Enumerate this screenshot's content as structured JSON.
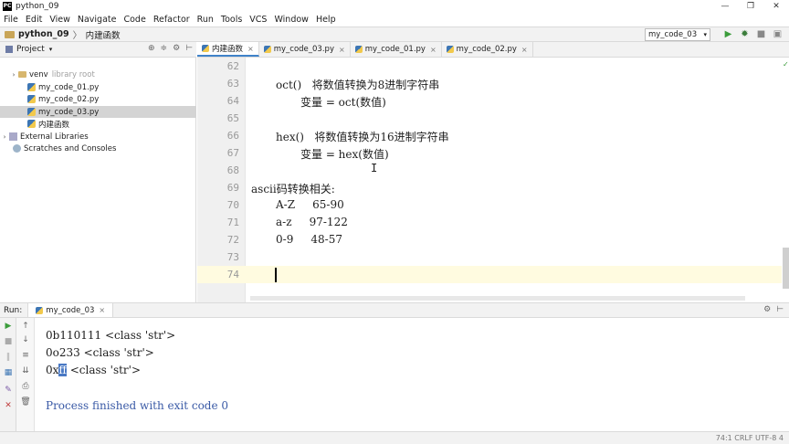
{
  "window": {
    "logo": "PC",
    "title": "python_09",
    "controls": [
      "—",
      "❐",
      "✕"
    ]
  },
  "menu": [
    "File",
    "Edit",
    "View",
    "Navigate",
    "Code",
    "Refactor",
    "Run",
    "Tools",
    "VCS",
    "Window",
    "Help"
  ],
  "navbar": {
    "project": "python_09",
    "separator": "〉",
    "file": "内建函数",
    "run_config": "my_code_03",
    "run_config_chevron": "▾",
    "tools": {
      "run": "▶",
      "debug": "✹",
      "stop": "■",
      "more": "▣"
    }
  },
  "project_panel": {
    "label": "Project",
    "chevron": "▾",
    "tools": [
      "⊕",
      "≑",
      "⚙",
      "⊢"
    ],
    "tree": [
      {
        "arrow": "›",
        "icon": "folder",
        "label": "venv",
        "extra": "library root",
        "selected": false
      },
      {
        "arrow": "",
        "icon": "py",
        "label": "my_code_01.py",
        "extra": "",
        "selected": false
      },
      {
        "arrow": "",
        "icon": "py",
        "label": "my_code_02.py",
        "extra": "",
        "selected": false
      },
      {
        "arrow": "",
        "icon": "py",
        "label": "my_code_03.py",
        "extra": "",
        "selected": true
      },
      {
        "arrow": "",
        "icon": "py",
        "label": "内建函数",
        "extra": "",
        "selected": false
      },
      {
        "arrow": "›",
        "icon": "lib",
        "label": "External Libraries",
        "extra": "",
        "selected": false
      },
      {
        "arrow": "",
        "icon": "scr",
        "label": "Scratches and Consoles",
        "extra": "",
        "selected": false
      }
    ]
  },
  "tabs": [
    {
      "label": "内建函数",
      "active": true
    },
    {
      "label": "my_code_03.py",
      "active": false
    },
    {
      "label": "my_code_01.py",
      "active": false
    },
    {
      "label": "my_code_02.py",
      "active": false
    }
  ],
  "tab_close": "×",
  "editor": {
    "check": "✓",
    "ibeam": "I",
    "lines": [
      {
        "n": "62",
        "text": "",
        "indent": 0
      },
      {
        "n": "63",
        "text": "oct()   将数值转换为8进制字符串",
        "indent": 2
      },
      {
        "n": "64",
        "text": "变量 = oct(数值)",
        "indent": 4
      },
      {
        "n": "65",
        "text": "",
        "indent": 0
      },
      {
        "n": "66",
        "text": "hex()   将数值转换为16进制字符串",
        "indent": 2
      },
      {
        "n": "67",
        "text": "变量 = hex(数值)",
        "indent": 4
      },
      {
        "n": "68",
        "text": "",
        "indent": 0
      },
      {
        "n": "69",
        "text": "ascii码转换相关:",
        "indent": 0
      },
      {
        "n": "70",
        "text": "A-Z     65-90",
        "indent": 2
      },
      {
        "n": "71",
        "text": "a-z     97-122",
        "indent": 2
      },
      {
        "n": "72",
        "text": "0-9     48-57",
        "indent": 2
      },
      {
        "n": "73",
        "text": "",
        "indent": 0
      },
      {
        "n": "74",
        "text": "",
        "indent": 0,
        "current": true
      }
    ]
  },
  "run_panel": {
    "label": "Run:",
    "tab": "my_code_03",
    "tools": [
      "⚙",
      "⊢"
    ],
    "console": {
      "line1": "0b110111 <class 'str'>",
      "line2": "0o233 <class 'str'>",
      "line3_prefix": "0x",
      "line3_selected": "ff",
      "line3_suffix": " <class 'str'>",
      "process": "Process finished with exit code 0"
    }
  },
  "status": {
    "right": "74:1  CRLF  UTF-8  4"
  }
}
